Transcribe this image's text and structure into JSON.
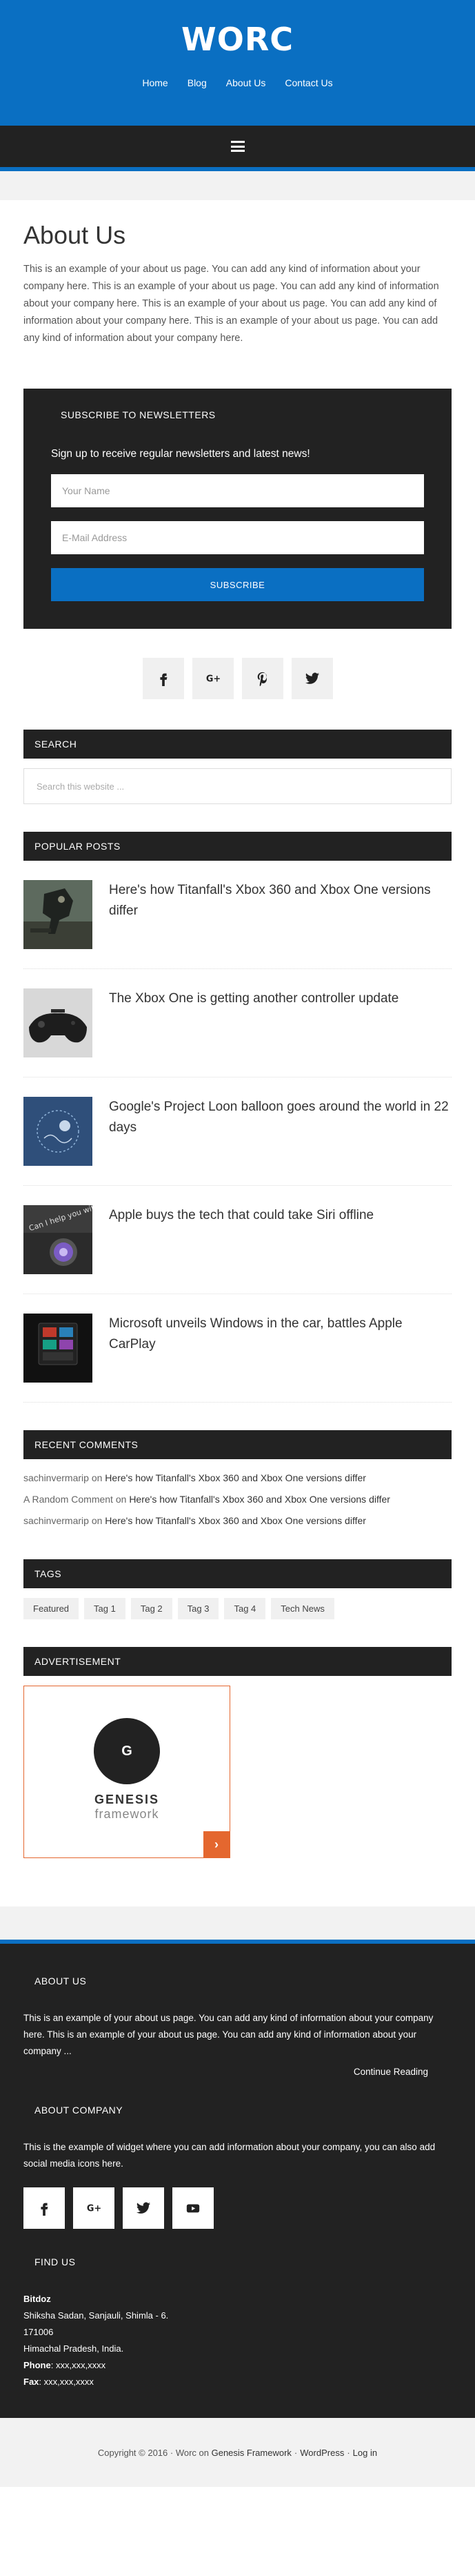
{
  "site": {
    "title": "WORC"
  },
  "nav": [
    {
      "label": "Home"
    },
    {
      "label": "Blog"
    },
    {
      "label": "About Us"
    },
    {
      "label": "Contact Us"
    }
  ],
  "page": {
    "title": "About Us",
    "body": "This is an example of your about us page. You can add any kind of information about your company here. This is an example of your about us page. You can add any kind of information about your company here. This is an example of your about us page. You can add any kind of information about your company here. This is an example of your about us page. You can add any kind of information about your company here."
  },
  "newsletter": {
    "heading": "SUBSCRIBE TO NEWSLETTERS",
    "text": "Sign up to receive regular newsletters and latest news!",
    "name_placeholder": "Your Name",
    "email_placeholder": "E-Mail Address",
    "button": "SUBSCRIBE"
  },
  "social_icons": [
    "facebook-icon",
    "google-plus-icon",
    "pinterest-icon",
    "twitter-icon"
  ],
  "search": {
    "heading": "SEARCH",
    "placeholder": "Search this website ..."
  },
  "popular": {
    "heading": "POPULAR POSTS",
    "posts": [
      {
        "title": "Here's how Titanfall's Xbox 360 and Xbox One versions differ"
      },
      {
        "title": "The Xbox One is getting another controller update"
      },
      {
        "title": "Google's Project Loon balloon goes around the world in 22 days"
      },
      {
        "title": "Apple buys the tech that could take Siri offline"
      },
      {
        "title": "Microsoft unveils Windows in the car, battles Apple CarPlay"
      }
    ]
  },
  "comments": {
    "heading": "RECENT COMMENTS",
    "items": [
      {
        "author": "sachinvermarip",
        "on": "on",
        "post": "Here's how Titanfall's Xbox 360 and Xbox One versions differ"
      },
      {
        "author": "A Random Comment",
        "on": "on",
        "post": "Here's how Titanfall's Xbox 360 and Xbox One versions differ"
      },
      {
        "author": "sachinvermarip",
        "on": "on",
        "post": "Here's how Titanfall's Xbox 360 and Xbox One versions differ"
      }
    ]
  },
  "tags": {
    "heading": "TAGS",
    "items": [
      "Featured",
      "Tag 1",
      "Tag 2",
      "Tag 3",
      "Tag 4",
      "Tech News"
    ]
  },
  "ad": {
    "heading": "ADVERTISEMENT",
    "logo_letter": "G",
    "brand": "GENESIS",
    "sub": "framework",
    "arrow": "›"
  },
  "footer": {
    "about": {
      "heading": "ABOUT US",
      "text": "This is an example of your about us page. You can add any kind of information about your company here. This is an example of your about us page. You can add any kind of information about your company ...",
      "link": "Continue Reading"
    },
    "company": {
      "heading": "ABOUT COMPANY",
      "text": "This is the example of widget where you can add information about your company, you can also add social media icons here."
    },
    "company_icons": [
      "facebook-icon",
      "google-plus-icon",
      "twitter-icon",
      "youtube-icon"
    ],
    "find": {
      "heading": "FIND US",
      "name": "Bitdoz",
      "line1": "Shiksha Sadan, Sanjauli, Shimla - 6.",
      "line2": "171006",
      "line3": "Himachal Pradesh, India.",
      "phone_label": "Phone",
      "phone": ": xxx,xxx,xxxx",
      "fax_label": "Fax",
      "fax": ": xxx,xxx,xxxx"
    }
  },
  "copyright": {
    "text": "Copyright © 2016 · Worc on",
    "framework": "Genesis Framework",
    "wordpress": "WordPress",
    "login": "Log in",
    "sep": "·"
  }
}
